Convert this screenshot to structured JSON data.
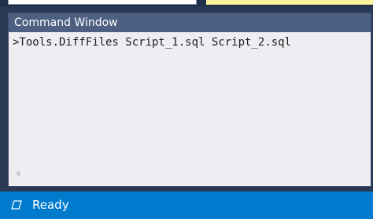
{
  "command_window": {
    "title": "Command Window",
    "lines": [
      ">Tools.DiffFiles Script_1.sql Script_2.sql"
    ]
  },
  "status_bar": {
    "text": "Ready",
    "icon": "status-window-icon",
    "background_color": "#007acc"
  },
  "colors": {
    "chrome": "#293955",
    "title_bar": "#4d6082",
    "panel": "#eeeef2",
    "highlight": "#fff29d"
  }
}
